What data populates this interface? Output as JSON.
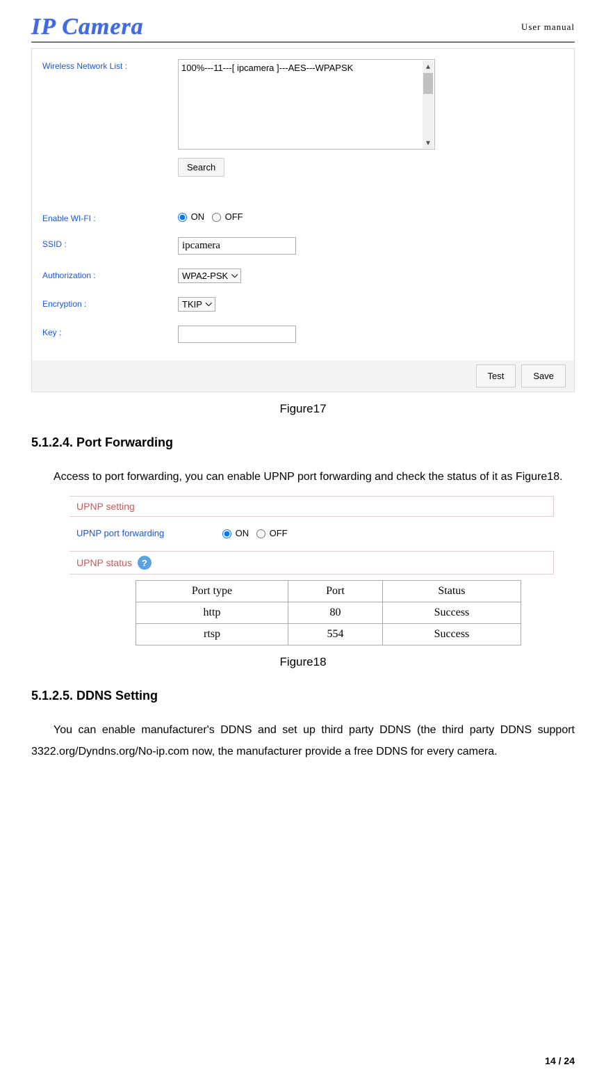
{
  "header": {
    "logo_text": "IP Camera",
    "doc_title": "User manual"
  },
  "figure17": {
    "caption": "Figure17",
    "wireless_list_label": "Wireless Network List :",
    "network_item": "100%---11---[ ipcamera ]---AES---WPAPSK",
    "search_btn": "Search",
    "enable_wifi_label": "Enable WI-FI :",
    "on_label": "ON",
    "off_label": "OFF",
    "ssid_label": "SSID :",
    "ssid_value": "ipcamera",
    "auth_label": "Authorization :",
    "auth_value": "WPA2-PSK",
    "encryption_label": "Encryption :",
    "encryption_value": "TKIP",
    "key_label": "Key :",
    "key_value": "",
    "test_btn": "Test",
    "save_btn": "Save"
  },
  "section_5124": {
    "heading": "5.1.2.4. Port Forwarding",
    "paragraph": "Access to port forwarding, you can enable UPNP port forwarding and check the status of it as Figure18."
  },
  "figure18": {
    "caption": "Figure18",
    "upnp_setting_header": "UPNP setting",
    "upnp_forward_label": "UPNP port forwarding",
    "on_label": "ON",
    "off_label": "OFF",
    "upnp_status_header": "UPNP status",
    "help_char": "?",
    "table": {
      "headers": [
        "Port type",
        "Port",
        "Status"
      ],
      "rows": [
        [
          "http",
          "80",
          "Success"
        ],
        [
          "rtsp",
          "554",
          "Success"
        ]
      ]
    }
  },
  "section_5125": {
    "heading": "5.1.2.5. DDNS Setting",
    "paragraph": "You can enable manufacturer's DDNS and set up third party DDNS (the third party DDNS support 3322.org/Dyndns.org/No-ip.com now, the manufacturer provide a free DDNS for every camera."
  },
  "page_number": "14 / 24"
}
